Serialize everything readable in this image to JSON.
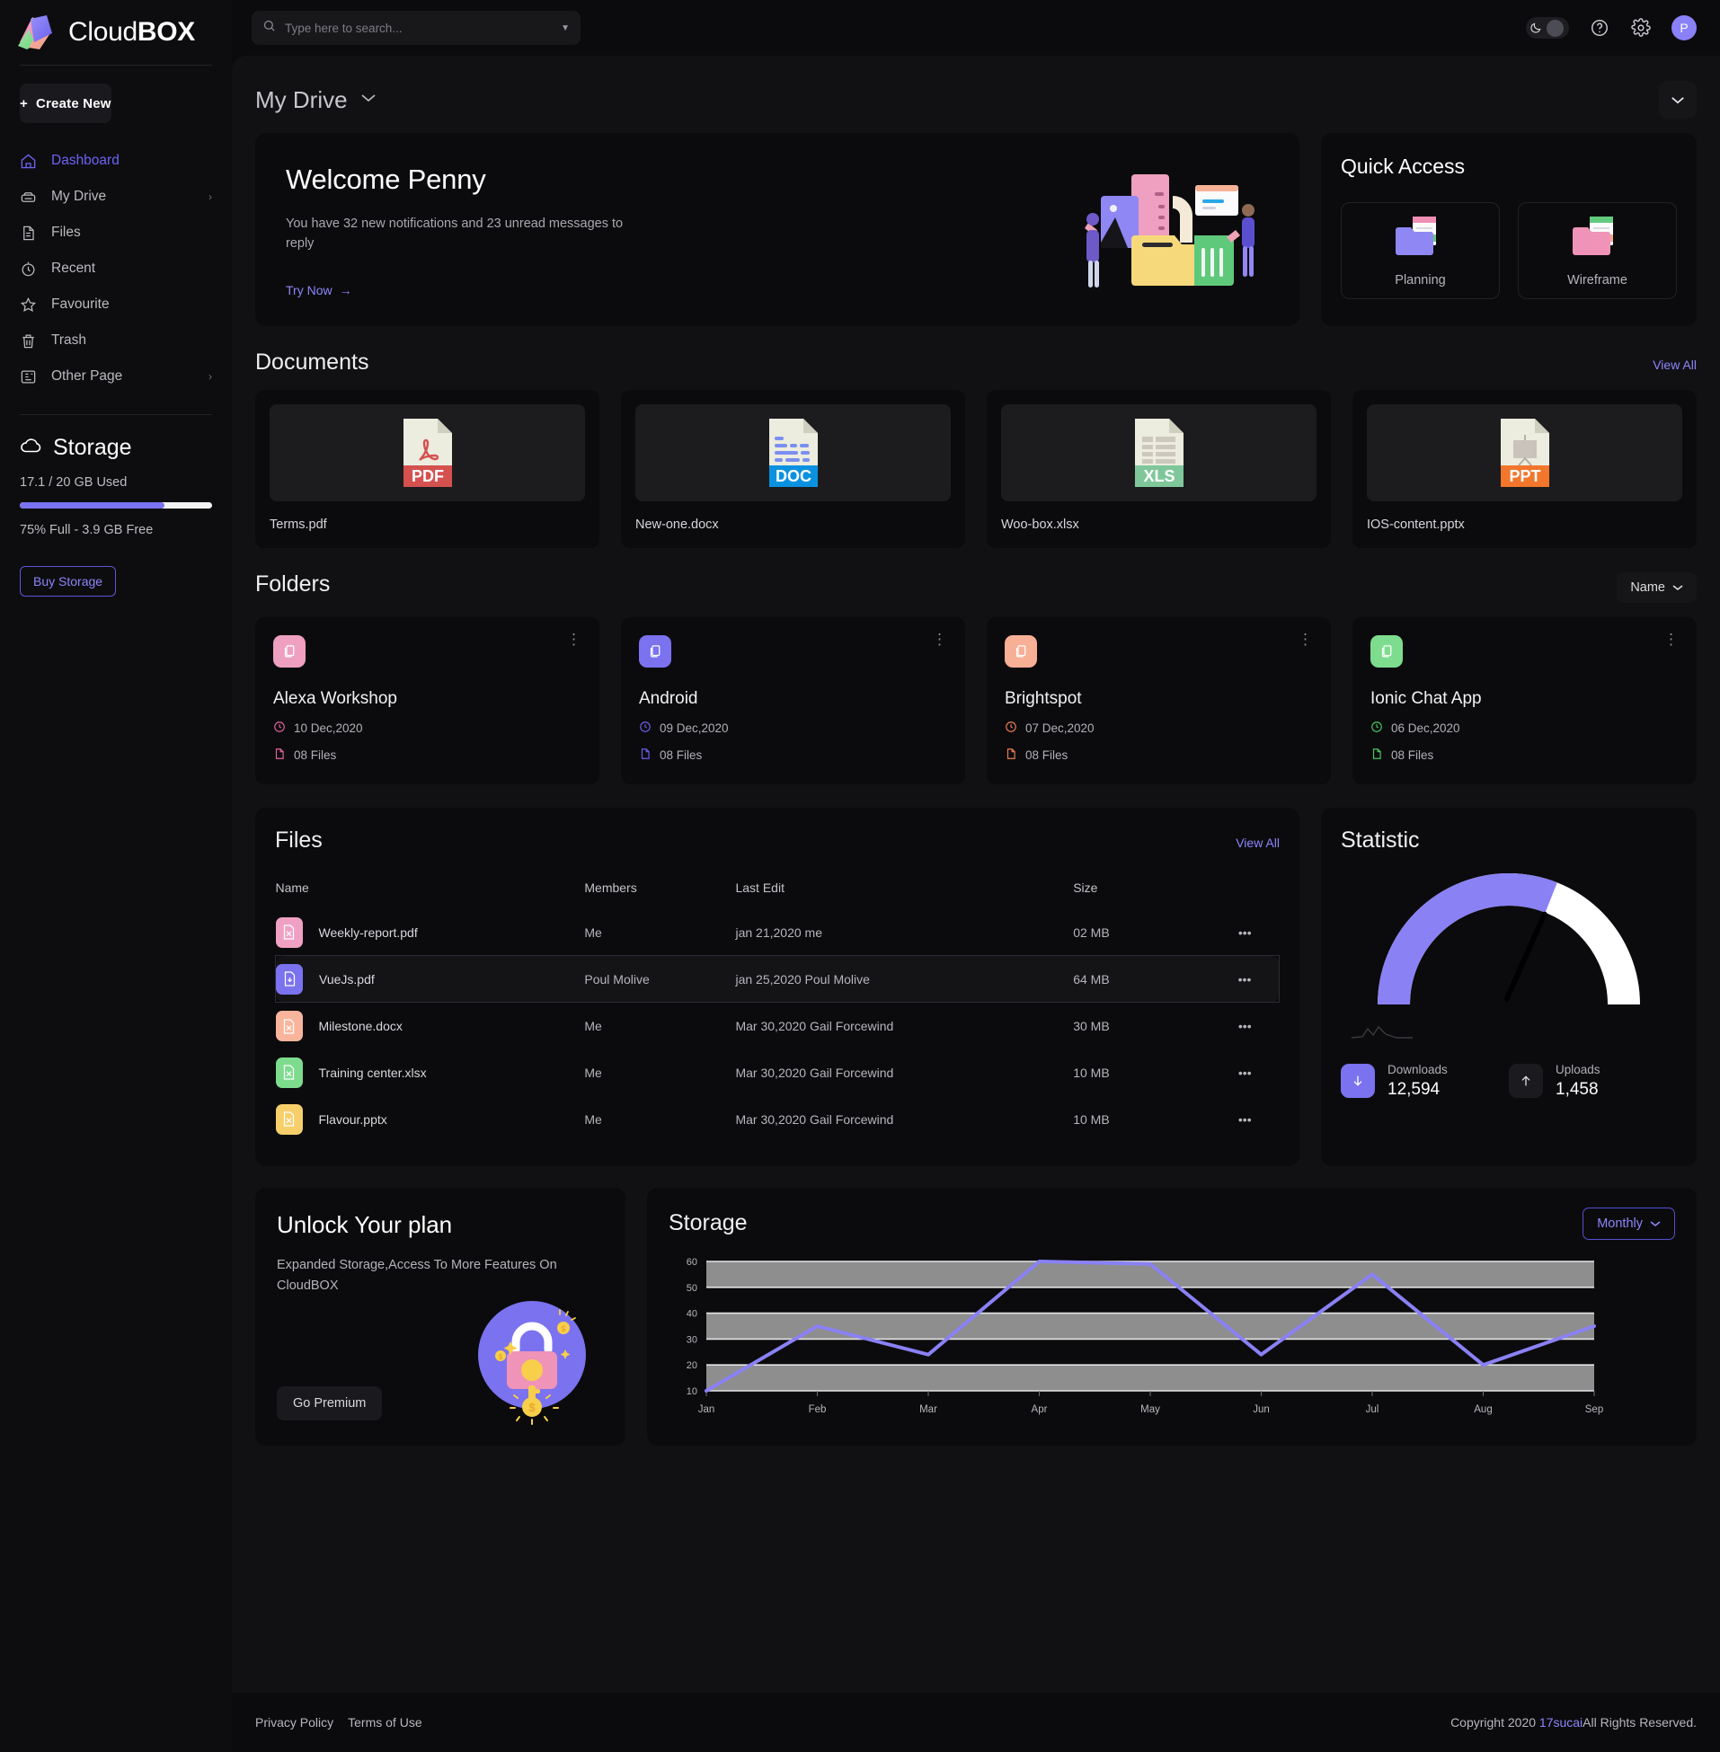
{
  "brand": {
    "name_light": "Cloud",
    "name_bold": "BOX"
  },
  "sidebar": {
    "create_new_label": "Create New",
    "items": [
      {
        "label": "Dashboard",
        "icon": "home-icon",
        "active": true,
        "chevron": ""
      },
      {
        "label": "My Drive",
        "icon": "drive-icon",
        "active": false,
        "chevron": "›"
      },
      {
        "label": "Files",
        "icon": "file-icon",
        "active": false,
        "chevron": ""
      },
      {
        "label": "Recent",
        "icon": "clock-icon",
        "active": false,
        "chevron": ""
      },
      {
        "label": "Favourite",
        "icon": "star-icon",
        "active": false,
        "chevron": ""
      },
      {
        "label": "Trash",
        "icon": "trash-icon",
        "active": false,
        "chevron": ""
      },
      {
        "label": "Other Page",
        "icon": "pages-icon",
        "active": false,
        "chevron": "›"
      }
    ],
    "storage": {
      "title": "Storage",
      "used_text": "17.1 / 20 GB Used",
      "free_text": "75% Full - 3.9 GB Free",
      "percent": 75,
      "buy_label": "Buy Storage",
      "fill_color": "#7b72f0"
    }
  },
  "topbar": {
    "search_placeholder": "Type here to search...",
    "search_value": "",
    "avatar_initial": "P"
  },
  "page": {
    "title": "My Drive"
  },
  "welcome": {
    "title": "Welcome Penny",
    "subtitle": "You have 32 new notifications and 23 unread messages to reply",
    "cta": "Try Now"
  },
  "quick_access": {
    "title": "Quick Access",
    "items": [
      {
        "label": "Planning",
        "color": "#7b72f0"
      },
      {
        "label": "Wireframe",
        "color": "#ef93b8"
      }
    ]
  },
  "documents": {
    "title": "Documents",
    "view_all": "View All",
    "items": [
      {
        "name": "Terms.pdf",
        "type": "PDF",
        "color": "#d4514f"
      },
      {
        "name": "New-one.docx",
        "type": "DOC",
        "color": "#0a92e0"
      },
      {
        "name": "Woo-box.xlsx",
        "type": "XLS",
        "color": "#7fc79a"
      },
      {
        "name": "IOS-content.pptx",
        "type": "PPT",
        "color": "#f2762b"
      }
    ]
  },
  "folders": {
    "title": "Folders",
    "sort_label": "Name",
    "items": [
      {
        "name": "Alexa Workshop",
        "date": "10 Dec,2020",
        "files": "08 Files",
        "color": "#efa0c0",
        "accent": "#e0649b"
      },
      {
        "name": "Android",
        "date": "09 Dec,2020",
        "files": "08 Files",
        "color": "#7b72f0",
        "accent": "#6a60ee"
      },
      {
        "name": "Brightspot",
        "date": "07 Dec,2020",
        "files": "08 Files",
        "color": "#f7af95",
        "accent": "#ef7d55"
      },
      {
        "name": "Ionic Chat App",
        "date": "06 Dec,2020",
        "files": "08 Files",
        "color": "#7ddc8d",
        "accent": "#46c95e"
      }
    ]
  },
  "files": {
    "title": "Files",
    "view_all": "View All",
    "columns": [
      "Name",
      "Members",
      "Last Edit",
      "Size"
    ],
    "rows": [
      {
        "name": "Weekly-report.pdf",
        "members": "Me",
        "last_edit": "jan 21,2020 me",
        "size": "02 MB",
        "color": "#f0a1c3",
        "highlight": false
      },
      {
        "name": "VueJs.pdf",
        "members": "Poul Molive",
        "last_edit": "jan 25,2020 Poul Molive",
        "size": "64 MB",
        "color": "#7b72f0",
        "highlight": true
      },
      {
        "name": "Milestone.docx",
        "members": "Me",
        "last_edit": "Mar 30,2020 Gail Forcewind",
        "size": "30 MB",
        "color": "#f9b59c",
        "highlight": false
      },
      {
        "name": "Training center.xlsx",
        "members": "Me",
        "last_edit": "Mar 30,2020 Gail Forcewind",
        "size": "10 MB",
        "color": "#7ddc8d",
        "highlight": false
      },
      {
        "name": "Flavour.pptx",
        "members": "Me",
        "last_edit": "Mar 30,2020 Gail Forcewind",
        "size": "10 MB",
        "color": "#f7cf6a",
        "highlight": false
      }
    ]
  },
  "statistic": {
    "title": "Statistic",
    "gauge_percent": 62,
    "gauge_color": "#8a81f5",
    "gauge_track_color": "#ffffff",
    "downloads_label": "Downloads",
    "downloads_value": "12,594",
    "uploads_label": "Uploads",
    "uploads_value": "1,458"
  },
  "plan": {
    "title": "Unlock Your plan",
    "subtitle": "Expanded Storage,Access To More Features On CloudBOX",
    "cta": "Go Premium"
  },
  "chart_data": {
    "type": "line",
    "title": "Storage",
    "range_label": "Monthly",
    "categories": [
      "Jan",
      "Feb",
      "Mar",
      "Apr",
      "May",
      "Jun",
      "Jul",
      "Aug",
      "Sep"
    ],
    "values": [
      10,
      35,
      24,
      60,
      59,
      24,
      55,
      20,
      35
    ],
    "series": [
      {
        "name": "Storage",
        "values": [
          10,
          35,
          24,
          60,
          59,
          24,
          55,
          20,
          35
        ],
        "color": "#8a81f5"
      }
    ],
    "xlabel": "",
    "ylabel": "",
    "yticks": [
      10,
      20,
      30,
      40,
      50,
      60
    ],
    "ylim": [
      10,
      60
    ],
    "grid": true,
    "banded_background": true,
    "legend": "none"
  },
  "footer": {
    "privacy": "Privacy Policy",
    "terms": "Terms of Use",
    "copyright_prefix": "Copyright 2020 ",
    "copyright_link": "17sucai",
    "copyright_suffix": "All Rights Reserved."
  }
}
